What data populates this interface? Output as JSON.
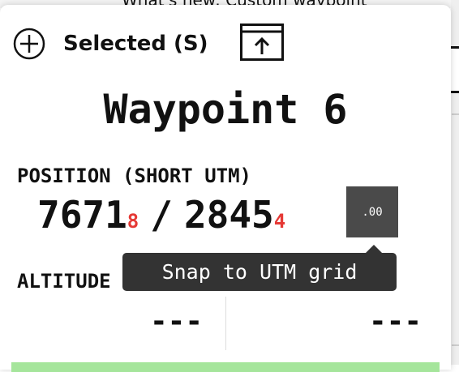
{
  "background": {
    "partial_text": "What's new: Custom waypoint"
  },
  "header": {
    "selected_label": "Selected (S)",
    "add_icon": "plus-circle-icon",
    "upload_icon": "upload-tray-icon"
  },
  "waypoint": {
    "title": "Waypoint 6"
  },
  "position": {
    "label": "POSITION (SHORT UTM)",
    "easting_major": "7671",
    "easting_minor": "8",
    "separator": "/",
    "northing_major": "2845",
    "northing_minor": "4",
    "snap_button_text": ".00"
  },
  "tooltip": {
    "text": "Snap to UTM grid"
  },
  "altitude": {
    "label": "ALTITUDE",
    "value_left": "---",
    "value_right": "---"
  },
  "colors": {
    "minor_digit": "#e53935",
    "snap_button_bg": "#4a4a4a",
    "tooltip_bg": "#333333",
    "progress_green": "#a5e59b"
  }
}
